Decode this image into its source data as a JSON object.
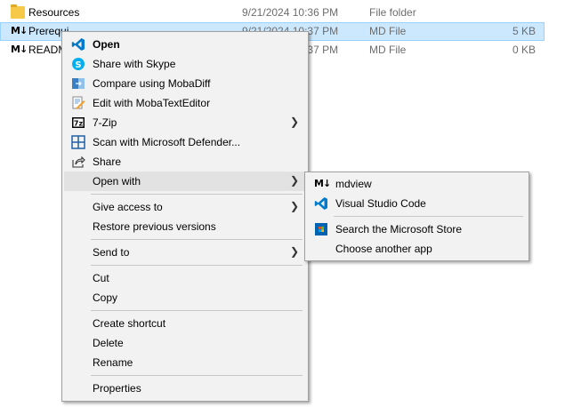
{
  "files": [
    {
      "name": "Resources",
      "date": "9/21/2024 10:36 PM",
      "type": "File folder",
      "size": "",
      "icon": "folder-icon"
    },
    {
      "name": "Prerequi",
      "date": "9/21/2024 10:37 PM",
      "type": "MD File",
      "size": "5 KB",
      "icon": "md-file-icon"
    },
    {
      "name": "READM",
      "date": "9/21/2024 10:37 PM",
      "type": "MD File",
      "size": "0 KB",
      "icon": "md-file-icon"
    }
  ],
  "context_menu": {
    "open": "Open",
    "share_skype": "Share with Skype",
    "compare_moba": "Compare using MobaDiff",
    "edit_moba": "Edit with MobaTextEditor",
    "seven_zip": "7-Zip",
    "scan_defender": "Scan with Microsoft Defender...",
    "share": "Share",
    "open_with": "Open with",
    "give_access": "Give access to",
    "restore_versions": "Restore previous versions",
    "send_to": "Send to",
    "cut": "Cut",
    "copy": "Copy",
    "create_shortcut": "Create shortcut",
    "delete": "Delete",
    "rename": "Rename",
    "properties": "Properties"
  },
  "open_with_menu": {
    "mdview": "mdview",
    "vscode": "Visual Studio Code",
    "search_store": "Search the Microsoft Store",
    "choose_app": "Choose another app"
  },
  "colors": {
    "selection": "#cce8ff",
    "menu_bg": "#f2f2f2",
    "highlight": "#e2e2e2",
    "vscode_blue": "#007acc",
    "skype_blue": "#00aff0"
  }
}
